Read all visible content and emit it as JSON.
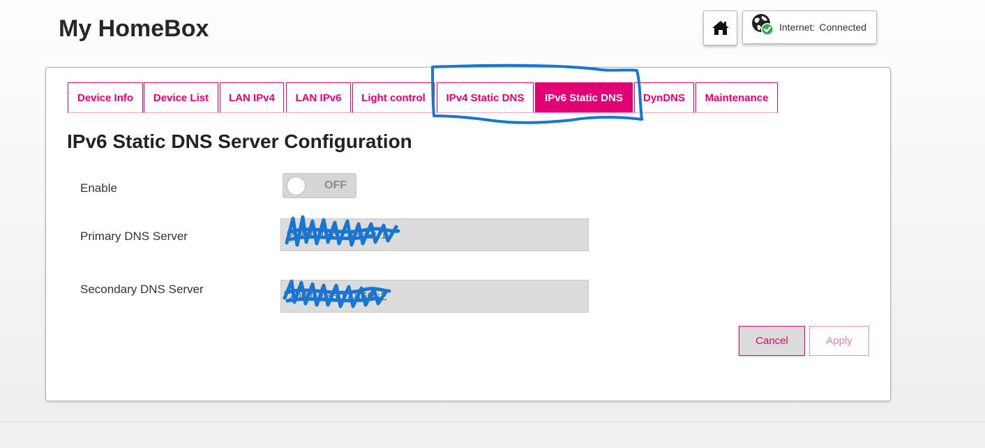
{
  "header": {
    "title": "My HomeBox",
    "home_icon": "home-icon",
    "status": {
      "label": "Internet:",
      "value": "Connected",
      "icon": "globe-check-icon"
    }
  },
  "tabs": [
    {
      "label": "Device Info",
      "active": false
    },
    {
      "label": "Device List",
      "active": false
    },
    {
      "label": "LAN IPv4",
      "active": false
    },
    {
      "label": "LAN IPv6",
      "active": false
    },
    {
      "label": "Light control",
      "active": false
    },
    {
      "label": "IPv4 Static DNS",
      "active": false
    },
    {
      "label": "IPv6 Static DNS",
      "active": true
    },
    {
      "label": "DynDNS",
      "active": false
    },
    {
      "label": "Maintenance",
      "active": false
    }
  ],
  "form": {
    "title": "IPv6 Static DNS Server Configuration",
    "enable": {
      "label": "Enable",
      "state": "OFF"
    },
    "primary": {
      "label": "Primary DNS Server",
      "value": "2001:4860:4860::1"
    },
    "secondary": {
      "label": "Secondary DNS Server",
      "value": "2001:4860:4860::2"
    }
  },
  "buttons": {
    "cancel": "Cancel",
    "apply": "Apply"
  },
  "colors": {
    "accent": "#e20074",
    "annotation_blue": "#1776d2",
    "input_bg": "#dcdcdc"
  }
}
